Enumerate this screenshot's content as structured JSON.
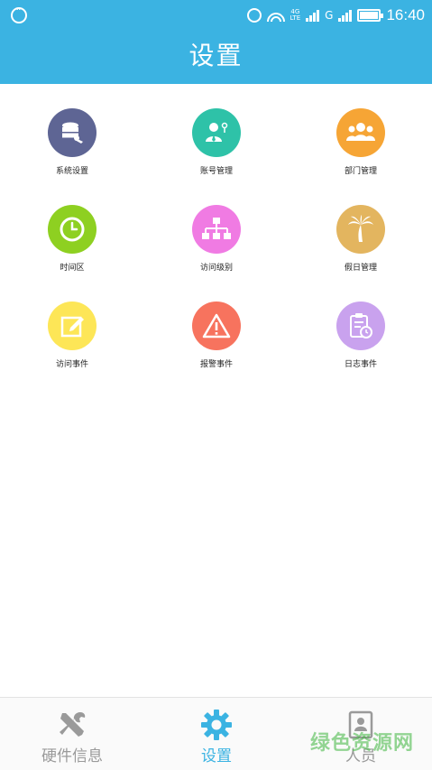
{
  "status_bar": {
    "time": "16:40",
    "network": "4G",
    "network_sub": "LTE",
    "carrier_g": "G"
  },
  "header": {
    "title": "设置",
    "color": "#3bb3e2"
  },
  "menu": [
    {
      "label": "系统设置",
      "icon": "database-gear-icon",
      "color": "#5e6594"
    },
    {
      "label": "账号管理",
      "icon": "user-account-icon",
      "color": "#2ec2a8"
    },
    {
      "label": "部门管理",
      "icon": "group-icon",
      "color": "#f6a535"
    },
    {
      "label": "时间区",
      "icon": "clock-icon",
      "color": "#8ed021"
    },
    {
      "label": "访问级别",
      "icon": "hierarchy-icon",
      "color": "#f07be3"
    },
    {
      "label": "假日管理",
      "icon": "palm-tree-icon",
      "color": "#e3b55f"
    },
    {
      "label": "访问事件",
      "icon": "edit-icon",
      "color": "#fde657"
    },
    {
      "label": "报警事件",
      "icon": "warning-icon",
      "color": "#f7735e"
    },
    {
      "label": "日志事件",
      "icon": "clipboard-clock-icon",
      "color": "#c9a2ee"
    }
  ],
  "tabs": [
    {
      "label": "硬件信息",
      "icon": "tools-icon",
      "active": false
    },
    {
      "label": "设置",
      "icon": "gear-icon",
      "active": true
    },
    {
      "label": "人员",
      "icon": "id-card-icon",
      "active": false
    }
  ],
  "watermark": "绿色资源网",
  "colors": {
    "tab_active": "#3bb3e2",
    "tab_inactive": "#9a9a9a"
  }
}
